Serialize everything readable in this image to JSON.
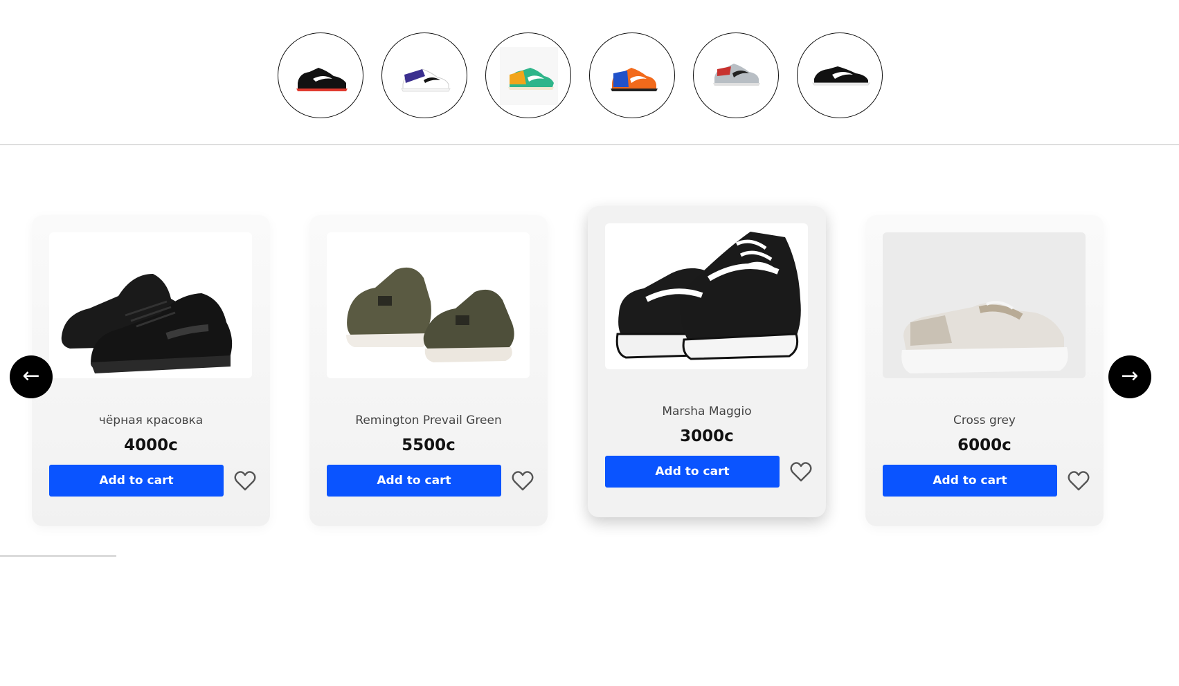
{
  "stories": [
    {
      "icon": "sneaker-thumbnail-black-white",
      "color": "#111111",
      "accent": "#ffffff",
      "sole": "#e03a2f"
    },
    {
      "icon": "sneaker-thumbnail-purple-white",
      "color": "#3b2f8f",
      "accent": "#ffffff",
      "sole": "#f5f5f5"
    },
    {
      "icon": "sneaker-thumbnail-green-orange",
      "color": "#2fb58a",
      "accent": "#f2a51a",
      "sole": "#f3e9d2"
    },
    {
      "icon": "sneaker-thumbnail-orange-blue",
      "color": "#f26a1b",
      "accent": "#2051c9",
      "sole": "#222222"
    },
    {
      "icon": "sneaker-thumbnail-grey-red",
      "color": "#b8bec4",
      "accent": "#c8322f",
      "sole": "#e0e0e0"
    },
    {
      "icon": "sneaker-thumbnail-black",
      "color": "#111111",
      "accent": "#ffffff",
      "sole": "#111111"
    }
  ],
  "products": [
    {
      "name": "чёрная красовка",
      "price": "4000с",
      "cart_label": "Add to cart",
      "image": "black-leather-sneakers"
    },
    {
      "name": "Remington Prevail Green",
      "price": "5500с",
      "cart_label": "Add to cart",
      "image": "olive-green-sneakers"
    },
    {
      "name": "Marsha Maggio",
      "price": "3000с",
      "cart_label": "Add to cart",
      "image": "black-white-chunky-sneakers"
    },
    {
      "name": "Cross grey",
      "price": "6000с",
      "cart_label": "Add to cart",
      "image": "grey-beige-sneaker"
    }
  ],
  "carousel": {
    "prev_label": "←",
    "next_label": "→",
    "active_index": 2
  },
  "colors": {
    "button": "#0a54ff",
    "arrow_bg": "#000000"
  }
}
